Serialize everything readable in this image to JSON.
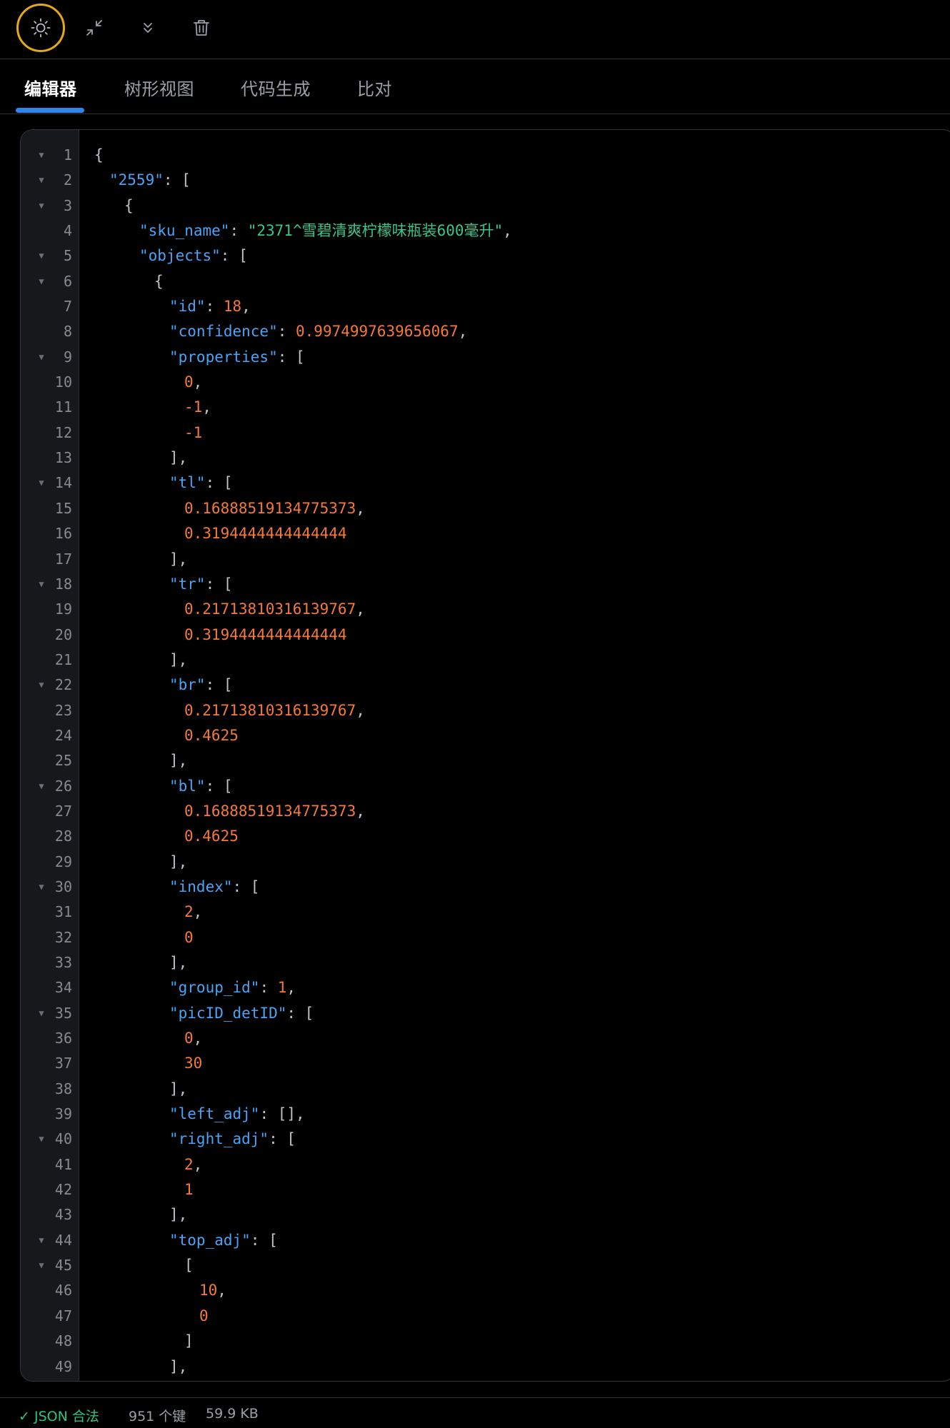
{
  "toolbar": {
    "buttons": [
      {
        "name": "theme-toggle",
        "icon": "sun-icon"
      },
      {
        "name": "collapse-all",
        "icon": "collapse-arrows-icon"
      },
      {
        "name": "expand-all",
        "icon": "double-chevron-down-icon"
      },
      {
        "name": "clear",
        "icon": "trash-icon"
      }
    ],
    "accent_color": "#e6a817"
  },
  "tabs": [
    {
      "label": "编辑器",
      "active": true
    },
    {
      "label": "树形视图",
      "active": false
    },
    {
      "label": "代码生成",
      "active": false
    },
    {
      "label": "比对",
      "active": false
    }
  ],
  "editor": {
    "colors": {
      "key": "#4ca3f5",
      "string": "#3ec488",
      "number": "#f37a3a",
      "punct": "#bfc3c8"
    },
    "lines": [
      {
        "n": "1",
        "fold": true,
        "indent": 0,
        "tokens": [
          [
            "p",
            "{"
          ]
        ]
      },
      {
        "n": "2",
        "fold": true,
        "indent": 1,
        "tokens": [
          [
            "k",
            "\"2559\""
          ],
          [
            "p",
            ": ["
          ]
        ]
      },
      {
        "n": "3",
        "fold": true,
        "indent": 2,
        "tokens": [
          [
            "p",
            "{"
          ]
        ]
      },
      {
        "n": "4",
        "fold": false,
        "indent": 3,
        "tokens": [
          [
            "k",
            "\"sku_name\""
          ],
          [
            "p",
            ": "
          ],
          [
            "s",
            "\"2371^雪碧清爽柠檬味瓶装600毫升\""
          ],
          [
            "p",
            ","
          ]
        ]
      },
      {
        "n": "5",
        "fold": true,
        "indent": 3,
        "tokens": [
          [
            "k",
            "\"objects\""
          ],
          [
            "p",
            ": ["
          ]
        ]
      },
      {
        "n": "6",
        "fold": true,
        "indent": 4,
        "tokens": [
          [
            "p",
            "{"
          ]
        ]
      },
      {
        "n": "7",
        "fold": false,
        "indent": 5,
        "tokens": [
          [
            "k",
            "\"id\""
          ],
          [
            "p",
            ": "
          ],
          [
            "n",
            "18"
          ],
          [
            "p",
            ","
          ]
        ]
      },
      {
        "n": "8",
        "fold": false,
        "indent": 5,
        "tokens": [
          [
            "k",
            "\"confidence\""
          ],
          [
            "p",
            ": "
          ],
          [
            "n",
            "0.9974997639656067"
          ],
          [
            "p",
            ","
          ]
        ]
      },
      {
        "n": "9",
        "fold": true,
        "indent": 5,
        "tokens": [
          [
            "k",
            "\"properties\""
          ],
          [
            "p",
            ": ["
          ]
        ]
      },
      {
        "n": "10",
        "fold": false,
        "indent": 6,
        "tokens": [
          [
            "n",
            "0"
          ],
          [
            "p",
            ","
          ]
        ]
      },
      {
        "n": "11",
        "fold": false,
        "indent": 6,
        "tokens": [
          [
            "n",
            "-1"
          ],
          [
            "p",
            ","
          ]
        ]
      },
      {
        "n": "12",
        "fold": false,
        "indent": 6,
        "tokens": [
          [
            "n",
            "-1"
          ]
        ]
      },
      {
        "n": "13",
        "fold": false,
        "indent": 5,
        "tokens": [
          [
            "p",
            "],"
          ]
        ]
      },
      {
        "n": "14",
        "fold": true,
        "indent": 5,
        "tokens": [
          [
            "k",
            "\"tl\""
          ],
          [
            "p",
            ": ["
          ]
        ]
      },
      {
        "n": "15",
        "fold": false,
        "indent": 6,
        "tokens": [
          [
            "n",
            "0.16888519134775373"
          ],
          [
            "p",
            ","
          ]
        ]
      },
      {
        "n": "16",
        "fold": false,
        "indent": 6,
        "tokens": [
          [
            "n",
            "0.3194444444444444"
          ]
        ]
      },
      {
        "n": "17",
        "fold": false,
        "indent": 5,
        "tokens": [
          [
            "p",
            "],"
          ]
        ]
      },
      {
        "n": "18",
        "fold": true,
        "indent": 5,
        "tokens": [
          [
            "k",
            "\"tr\""
          ],
          [
            "p",
            ": ["
          ]
        ]
      },
      {
        "n": "19",
        "fold": false,
        "indent": 6,
        "tokens": [
          [
            "n",
            "0.21713810316139767"
          ],
          [
            "p",
            ","
          ]
        ]
      },
      {
        "n": "20",
        "fold": false,
        "indent": 6,
        "tokens": [
          [
            "n",
            "0.3194444444444444"
          ]
        ]
      },
      {
        "n": "21",
        "fold": false,
        "indent": 5,
        "tokens": [
          [
            "p",
            "],"
          ]
        ]
      },
      {
        "n": "22",
        "fold": true,
        "indent": 5,
        "tokens": [
          [
            "k",
            "\"br\""
          ],
          [
            "p",
            ": ["
          ]
        ]
      },
      {
        "n": "23",
        "fold": false,
        "indent": 6,
        "tokens": [
          [
            "n",
            "0.21713810316139767"
          ],
          [
            "p",
            ","
          ]
        ]
      },
      {
        "n": "24",
        "fold": false,
        "indent": 6,
        "tokens": [
          [
            "n",
            "0.4625"
          ]
        ]
      },
      {
        "n": "25",
        "fold": false,
        "indent": 5,
        "tokens": [
          [
            "p",
            "],"
          ]
        ]
      },
      {
        "n": "26",
        "fold": true,
        "indent": 5,
        "tokens": [
          [
            "k",
            "\"bl\""
          ],
          [
            "p",
            ": ["
          ]
        ]
      },
      {
        "n": "27",
        "fold": false,
        "indent": 6,
        "tokens": [
          [
            "n",
            "0.16888519134775373"
          ],
          [
            "p",
            ","
          ]
        ]
      },
      {
        "n": "28",
        "fold": false,
        "indent": 6,
        "tokens": [
          [
            "n",
            "0.4625"
          ]
        ]
      },
      {
        "n": "29",
        "fold": false,
        "indent": 5,
        "tokens": [
          [
            "p",
            "],"
          ]
        ]
      },
      {
        "n": "30",
        "fold": true,
        "indent": 5,
        "tokens": [
          [
            "k",
            "\"index\""
          ],
          [
            "p",
            ": ["
          ]
        ]
      },
      {
        "n": "31",
        "fold": false,
        "indent": 6,
        "tokens": [
          [
            "n",
            "2"
          ],
          [
            "p",
            ","
          ]
        ]
      },
      {
        "n": "32",
        "fold": false,
        "indent": 6,
        "tokens": [
          [
            "n",
            "0"
          ]
        ]
      },
      {
        "n": "33",
        "fold": false,
        "indent": 5,
        "tokens": [
          [
            "p",
            "],"
          ]
        ]
      },
      {
        "n": "34",
        "fold": false,
        "indent": 5,
        "tokens": [
          [
            "k",
            "\"group_id\""
          ],
          [
            "p",
            ": "
          ],
          [
            "n",
            "1"
          ],
          [
            "p",
            ","
          ]
        ]
      },
      {
        "n": "35",
        "fold": true,
        "indent": 5,
        "tokens": [
          [
            "k",
            "\"picID_detID\""
          ],
          [
            "p",
            ": ["
          ]
        ]
      },
      {
        "n": "36",
        "fold": false,
        "indent": 6,
        "tokens": [
          [
            "n",
            "0"
          ],
          [
            "p",
            ","
          ]
        ]
      },
      {
        "n": "37",
        "fold": false,
        "indent": 6,
        "tokens": [
          [
            "n",
            "30"
          ]
        ]
      },
      {
        "n": "38",
        "fold": false,
        "indent": 5,
        "tokens": [
          [
            "p",
            "],"
          ]
        ]
      },
      {
        "n": "39",
        "fold": false,
        "indent": 5,
        "tokens": [
          [
            "k",
            "\"left_adj\""
          ],
          [
            "p",
            ": [],"
          ]
        ]
      },
      {
        "n": "40",
        "fold": true,
        "indent": 5,
        "tokens": [
          [
            "k",
            "\"right_adj\""
          ],
          [
            "p",
            ": ["
          ]
        ]
      },
      {
        "n": "41",
        "fold": false,
        "indent": 6,
        "tokens": [
          [
            "n",
            "2"
          ],
          [
            "p",
            ","
          ]
        ]
      },
      {
        "n": "42",
        "fold": false,
        "indent": 6,
        "tokens": [
          [
            "n",
            "1"
          ]
        ]
      },
      {
        "n": "43",
        "fold": false,
        "indent": 5,
        "tokens": [
          [
            "p",
            "],"
          ]
        ]
      },
      {
        "n": "44",
        "fold": true,
        "indent": 5,
        "tokens": [
          [
            "k",
            "\"top_adj\""
          ],
          [
            "p",
            ": ["
          ]
        ]
      },
      {
        "n": "45",
        "fold": true,
        "indent": 6,
        "tokens": [
          [
            "p",
            "["
          ]
        ]
      },
      {
        "n": "46",
        "fold": false,
        "indent": 7,
        "tokens": [
          [
            "n",
            "10"
          ],
          [
            "p",
            ","
          ]
        ]
      },
      {
        "n": "47",
        "fold": false,
        "indent": 7,
        "tokens": [
          [
            "n",
            "0"
          ]
        ]
      },
      {
        "n": "48",
        "fold": false,
        "indent": 6,
        "tokens": [
          [
            "p",
            "]"
          ]
        ]
      },
      {
        "n": "49",
        "fold": false,
        "indent": 5,
        "tokens": [
          [
            "p",
            "],"
          ]
        ]
      }
    ]
  },
  "status": {
    "valid": "✓ JSON 合法",
    "keys": "951 个键",
    "size": "59.9 KB",
    "valid_color": "#32c27a"
  }
}
